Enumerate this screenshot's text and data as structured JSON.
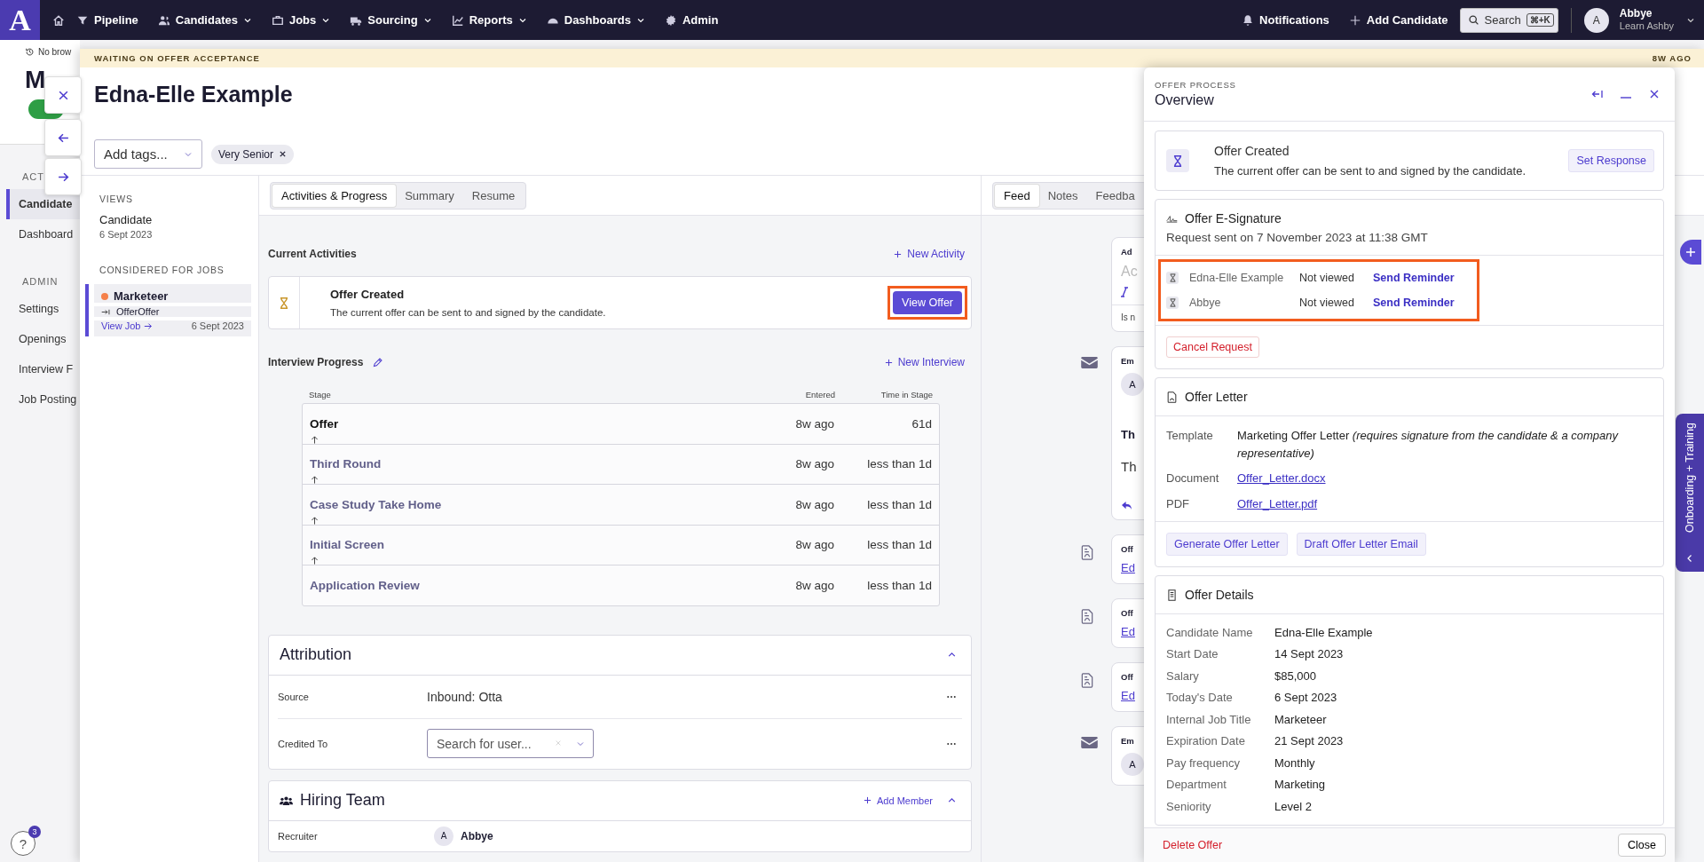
{
  "nav": {
    "logo": "A",
    "items": [
      {
        "label": "Pipeline",
        "dropdown": false
      },
      {
        "label": "Candidates",
        "dropdown": true
      },
      {
        "label": "Jobs",
        "dropdown": true
      },
      {
        "label": "Sourcing",
        "dropdown": true
      },
      {
        "label": "Reports",
        "dropdown": true
      },
      {
        "label": "Dashboards",
        "dropdown": true
      },
      {
        "label": "Admin",
        "dropdown": false
      }
    ],
    "notifications": "Notifications",
    "add_candidate": "Add Candidate",
    "search": "Search",
    "search_shortcut": "⌘+K",
    "user": {
      "initial": "A",
      "name": "Abbye",
      "org": "Learn Ashby"
    }
  },
  "background_page": {
    "history": "No brow",
    "title": "M",
    "sections": [
      {
        "heading": "ACT",
        "items": [
          {
            "label": "Candidate",
            "selected": true
          },
          {
            "label": "Dashboard",
            "selected": false
          }
        ]
      },
      {
        "heading": "ADMIN",
        "items": [
          {
            "label": "Settings",
            "selected": false
          },
          {
            "label": "Openings",
            "selected": false
          },
          {
            "label": "Interview F",
            "selected": false
          },
          {
            "label": "Job Posting",
            "selected": false
          }
        ]
      }
    ]
  },
  "help": {
    "label": "?",
    "badge": "3"
  },
  "candidate": {
    "status": "WAITING ON OFFER ACCEPTANCE",
    "status_age": "8W AGO",
    "name": "Edna-Elle Example",
    "tags_placeholder": "Add tags...",
    "tags": [
      "Very Senior"
    ]
  },
  "views": {
    "heading": "VIEWS",
    "items": [
      {
        "title": "Candidate",
        "date": "6 Sept 2023"
      }
    ],
    "jobs_heading": "CONSIDERED FOR JOBS",
    "jobs": [
      {
        "title": "Marketeer",
        "color": "#f5804a",
        "stage": "OfferOffer",
        "link": "View Job",
        "date": "6 Sept 2023",
        "selected": true
      }
    ]
  },
  "tabs": [
    {
      "label": "Activities & Progress",
      "selected": true
    },
    {
      "label": "Summary",
      "selected": false
    },
    {
      "label": "Resume",
      "selected": false
    }
  ],
  "current_activities": {
    "title": "Current Activities",
    "action": "New Activity",
    "items": [
      {
        "title": "Offer Created",
        "description": "The current offer can be sent to and signed by the candidate.",
        "button": "View Offer",
        "highlighted": true
      }
    ]
  },
  "interview_progress": {
    "title": "Interview Progress",
    "action": "New Interview",
    "columns": [
      "Stage",
      "Entered",
      "Time in Stage"
    ],
    "stages": [
      {
        "name": "Offer",
        "entered": "8w ago",
        "time": "61d",
        "current": true
      },
      {
        "name": "Third Round",
        "entered": "8w ago",
        "time": "less than 1d",
        "current": false
      },
      {
        "name": "Case Study Take Home",
        "entered": "8w ago",
        "time": "less than 1d",
        "current": false
      },
      {
        "name": "Initial Screen",
        "entered": "8w ago",
        "time": "less than 1d",
        "current": false
      },
      {
        "name": "Application Review",
        "entered": "8w ago",
        "time": "less than 1d",
        "current": false
      }
    ]
  },
  "attribution": {
    "title": "Attribution",
    "expanded": true,
    "source_label": "Source",
    "source": "Inbound: Otta",
    "credited_label": "Credited To",
    "credited_placeholder": "Search for user..."
  },
  "hiring_team": {
    "title": "Hiring Team",
    "action": "Add Member",
    "expanded": true,
    "members": [
      {
        "role": "Recruiter",
        "initial": "A",
        "name": "Abbye"
      }
    ]
  },
  "feed": {
    "tabs": [
      {
        "label": "Feed",
        "selected": true
      },
      {
        "label": "Notes",
        "selected": false
      },
      {
        "label": "Feedba",
        "selected": false
      }
    ],
    "items": [
      {
        "kind": "composer",
        "title": "Ad",
        "placeholder": "Ac",
        "footer": "Is n"
      },
      {
        "kind": "email",
        "title": "Em",
        "initial": "A",
        "subject": "Th",
        "body": "Th"
      },
      {
        "kind": "offer",
        "title": "Off",
        "link": "Ed"
      },
      {
        "kind": "offer",
        "title": "Off",
        "link": "Ed"
      },
      {
        "kind": "offer",
        "title": "Off",
        "link": "Ed"
      },
      {
        "kind": "email",
        "title": "Em",
        "initial": "A"
      }
    ]
  },
  "offer_panel": {
    "eyebrow": "OFFER PROCESS",
    "title": "Overview",
    "status": {
      "title": "Offer Created",
      "description": "The current offer can be sent to and signed by the candidate.",
      "button": "Set Response"
    },
    "esignature": {
      "title": "Offer E-Signature",
      "sent": "Request sent on 7 November 2023 at 11:38 GMT",
      "highlighted": true,
      "signers": [
        {
          "name": "Edna-Elle Example",
          "status": "Not viewed",
          "action": "Send Reminder"
        },
        {
          "name": "Abbye",
          "status": "Not viewed",
          "action": "Send Reminder"
        }
      ],
      "cancel": "Cancel Request"
    },
    "letter": {
      "title": "Offer Letter",
      "fields": [
        {
          "kind": "text",
          "label": "Template",
          "value": "Marketing Offer Letter  *(requires signature from the candidate & a company representative)*"
        },
        {
          "kind": "link",
          "label": "Document",
          "value": "Offer_Letter.docx"
        },
        {
          "kind": "link",
          "label": "PDF",
          "value": "Offer_Letter.pdf"
        }
      ],
      "buttons": [
        "Generate Offer Letter",
        "Draft Offer Letter Email"
      ]
    },
    "details": {
      "title": "Offer Details",
      "rows": [
        {
          "label": "Candidate Name",
          "value": "Edna-Elle Example"
        },
        {
          "label": "Start Date",
          "value": "14 Sept 2023"
        },
        {
          "label": "Salary",
          "value": "$85,000"
        },
        {
          "label": "Today's Date",
          "value": "6 Sept 2023"
        },
        {
          "label": "Internal Job Title",
          "value": "Marketeer"
        },
        {
          "label": "Expiration Date",
          "value": "21 Sept 2023"
        },
        {
          "label": "Pay frequency",
          "value": "Monthly"
        },
        {
          "label": "Department",
          "value": "Marketing"
        },
        {
          "label": "Seniority",
          "value": "Level 2"
        }
      ]
    },
    "delete": "Delete Offer",
    "close": "Close"
  },
  "onboarding": {
    "label": "Onboarding + Training"
  }
}
